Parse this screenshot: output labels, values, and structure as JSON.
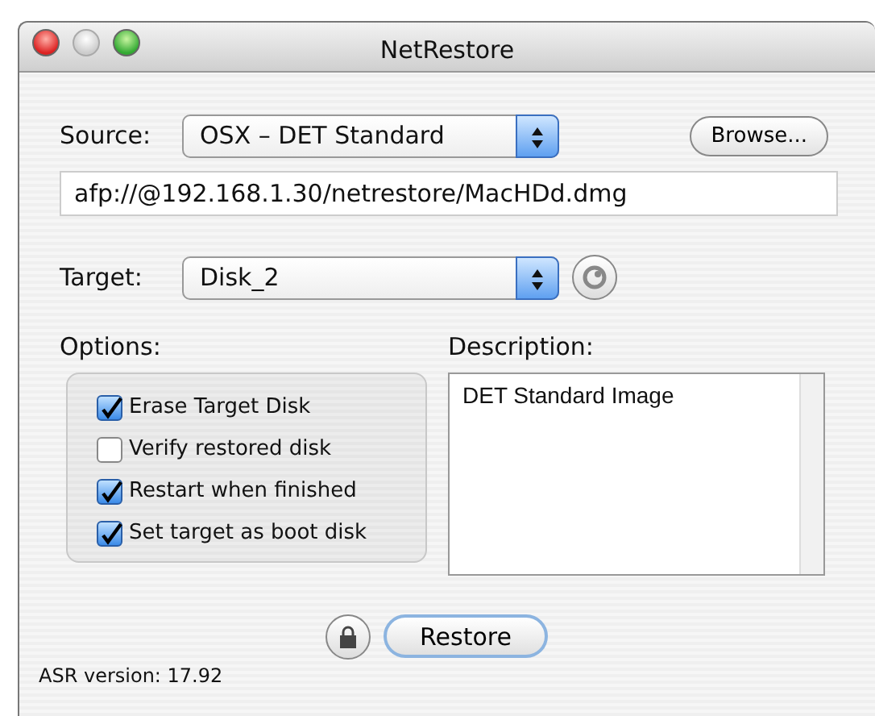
{
  "window": {
    "title": "NetRestore"
  },
  "source": {
    "label": "Source:",
    "value": "OSX – DET Standard",
    "browse": "Browse...",
    "path": "afp://@192.168.1.30/netrestore/MacHDd.dmg"
  },
  "target": {
    "label": "Target:",
    "value": "Disk_2"
  },
  "options": {
    "label": "Options:",
    "items": [
      {
        "label": "Erase Target Disk",
        "checked": true
      },
      {
        "label": "Verify restored disk",
        "checked": false
      },
      {
        "label": "Restart when finished",
        "checked": true
      },
      {
        "label": "Set target as boot disk",
        "checked": true
      }
    ]
  },
  "description": {
    "label": "Description:",
    "text": "DET Standard Image"
  },
  "restore_button": "Restore",
  "status": "ASR version: 17.92"
}
